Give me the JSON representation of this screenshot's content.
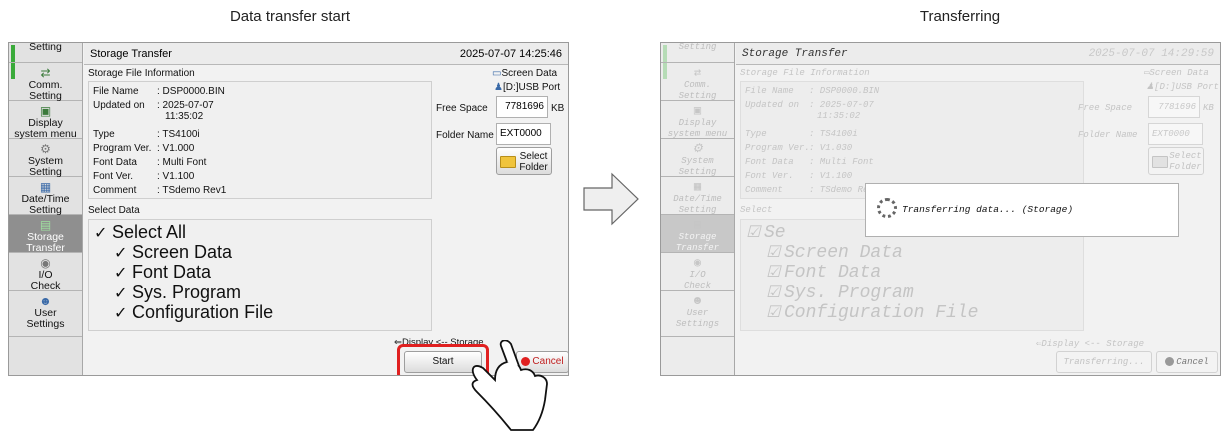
{
  "captions": {
    "left": "Data transfer start",
    "right": "Transferring"
  },
  "panel_a": {
    "sidebar": [
      {
        "label": "Setting",
        "icon": "gear-icon"
      },
      {
        "label": "Comm.\nSetting",
        "icon": "comm-icon"
      },
      {
        "label": "Display\nsystem menu",
        "icon": "display-icon"
      },
      {
        "label": "System\nSetting",
        "icon": "system-icon"
      },
      {
        "label": "Date/Time\nSetting",
        "icon": "calendar-icon"
      },
      {
        "label": "Storage\nTransfer",
        "icon": "storage-icon"
      },
      {
        "label": "I/O\nCheck",
        "icon": "io-icon"
      },
      {
        "label": "User\nSettings",
        "icon": "user-icon"
      }
    ],
    "title": "Storage Transfer",
    "clock": "2025-07-07  14:25:46",
    "info_header": "Storage File Information",
    "info": [
      {
        "key": "File Name",
        "value": ": DSP0000.BIN"
      },
      {
        "key": "Updated on",
        "value": ": 2025-07-07"
      },
      {
        "key": "",
        "value": "11:35:02"
      },
      {
        "key": "Type",
        "value": ": TS4100i"
      },
      {
        "key": "Program Ver.",
        "value": ": V1.000"
      },
      {
        "key": "Font Data",
        "value": ": Multi Font"
      },
      {
        "key": "Font Ver.",
        "value": ": V1.100"
      },
      {
        "key": "Comment",
        "value": ": TSdemo Rev1"
      }
    ],
    "screen_data_label": "Screen Data",
    "port_label": "[D:]USB Port",
    "free_space_label": "Free Space",
    "free_space_value": "7781696",
    "free_space_unit": "KB",
    "folder_name_label": "Folder Name",
    "folder_name_value": "EXT0000",
    "select_folder_line1": "Select",
    "select_folder_line2": "Folder",
    "select_header": "Select Data",
    "checks": [
      "Select All",
      "Screen Data",
      "Font Data",
      "Sys. Program",
      "Configuration File"
    ],
    "direction": "Display <-- Storage",
    "start_label": "Start",
    "cancel_label": "Cancel"
  },
  "panel_b": {
    "sidebar": [
      {
        "label": "Setting",
        "icon": "gear-icon"
      },
      {
        "label": "Comm.\nSetting",
        "icon": "comm-icon"
      },
      {
        "label": "Display\nsystem menu",
        "icon": "display-icon"
      },
      {
        "label": "System\nSetting",
        "icon": "system-icon"
      },
      {
        "label": "Date/Time\nSetting",
        "icon": "calendar-icon"
      },
      {
        "label": "Storage\nTransfer",
        "icon": "storage-icon"
      },
      {
        "label": "I/O\nCheck",
        "icon": "io-icon"
      },
      {
        "label": "User\nSettings",
        "icon": "user-icon"
      }
    ],
    "title": "Storage Transfer",
    "clock": "2025-07-07  14:29:59",
    "info_header": "Storage File Information",
    "info": [
      {
        "key": "File Name",
        "value": ": DSP0000.BIN"
      },
      {
        "key": "Updated on",
        "value": ": 2025-07-07"
      },
      {
        "key": "",
        "value": "11:35:02"
      },
      {
        "key": "Type",
        "value": ": TS4100i"
      },
      {
        "key": "Program Ver.",
        "value": ": V1.030"
      },
      {
        "key": "Font Data",
        "value": ": Multi Font"
      },
      {
        "key": "Font Ver.",
        "value": ": V1.100"
      },
      {
        "key": "Comment",
        "value": ": TSdemo Rev1"
      }
    ],
    "screen_data_label": "Screen Data",
    "port_label": "[D:]USB Port",
    "free_space_label": "Free Space",
    "free_space_value": "7781696",
    "free_space_unit": "KB",
    "folder_name_label": "Folder Name",
    "folder_name_value": "EXT0000",
    "select_folder_line1": "Select",
    "select_folder_line2": "Folder",
    "select_header": "Select",
    "select_header_suffix": "Se",
    "checks": [
      "Screen Data",
      "Font Data",
      "Sys. Program",
      "Configuration File"
    ],
    "direction": "Display <-- Storage",
    "transferring_label": "Transferring...",
    "cancel_label": "Cancel",
    "dialog_text": "Transferring data... (Storage)"
  },
  "colors": {
    "highlight": "#e02020",
    "active_sidebar": "#8f8f8f",
    "folder": "#f0c43c"
  }
}
